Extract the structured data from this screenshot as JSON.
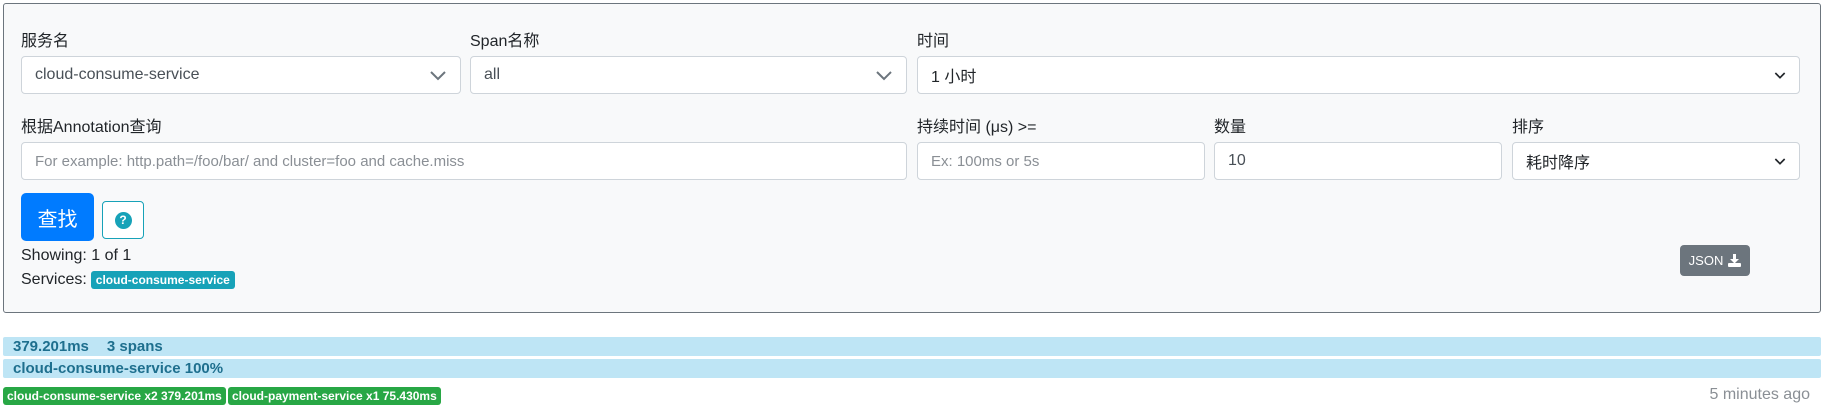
{
  "form": {
    "service_name_label": "服务名",
    "service_name_value": "cloud-consume-service",
    "span_name_label": "Span名称",
    "span_name_value": "all",
    "time_label": "时间",
    "time_value": "1 小时",
    "annotation_label": "根据Annotation查询",
    "annotation_placeholder": "For example: http.path=/foo/bar/ and cluster=foo and cache.miss",
    "duration_label": "持续时间 (μs) >=",
    "duration_placeholder": "Ex: 100ms or 5s",
    "limit_label": "数量",
    "limit_value": "10",
    "sort_label": "排序",
    "sort_value": "耗时降序",
    "find_button": "查找",
    "help_icon_glyph": "?"
  },
  "results": {
    "showing_text": "Showing: 1 of 1",
    "services_label": "Services:",
    "services_badge": "cloud-consume-service",
    "json_button": "JSON"
  },
  "trace": {
    "duration": "379.201ms",
    "spans": "3 spans",
    "service_summary": "cloud-consume-service 100%",
    "tags": [
      "cloud-consume-service x2 379.201ms",
      "cloud-payment-service x1 75.430ms"
    ],
    "time_ago": "5 minutes ago"
  },
  "colors": {
    "primary": "#007bff",
    "info": "#17a2b8",
    "success": "#28a745",
    "secondary": "#6c757d",
    "trace_bar": "#bee5f5"
  }
}
